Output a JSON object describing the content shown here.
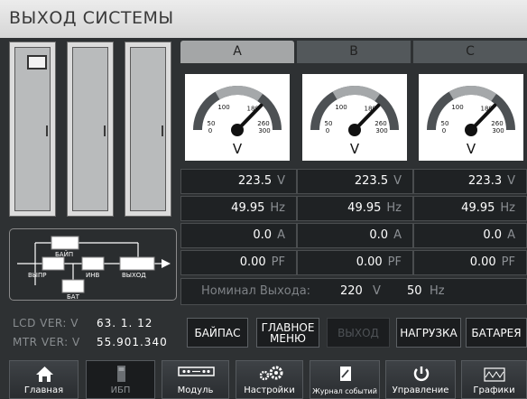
{
  "title": "ВЫХОД СИСТЕМЫ",
  "diagram": {
    "bypass": "БАЙП",
    "rectifier": "ВЫПР",
    "inverter": "ИНВ",
    "output": "ВЫХОД",
    "battery": "БАТ"
  },
  "phases": [
    {
      "label": "A",
      "voltage": "223.5",
      "frequency": "49.95",
      "current": "0.0",
      "pf": "0.00"
    },
    {
      "label": "B",
      "voltage": "223.5",
      "frequency": "49.95",
      "current": "0.0",
      "pf": "0.00"
    },
    {
      "label": "C",
      "voltage": "223.3",
      "frequency": "49.95",
      "current": "0.0",
      "pf": "0.00"
    }
  ],
  "gauge": {
    "ticks": [
      "0",
      "50",
      "100",
      "180",
      "260",
      "300"
    ],
    "unit": "V"
  },
  "units": {
    "voltage": "V",
    "frequency": "Hz",
    "current": "A",
    "pf": "PF"
  },
  "nominal": {
    "label": "Номинал Выхода:",
    "voltage": "220",
    "voltage_unit": "V",
    "frequency": "50",
    "frequency_unit": "Hz"
  },
  "versions": {
    "lcd_label": "LCD VER: V",
    "lcd_value": "63.  1. 12",
    "mtr_label": "MTR VER: V",
    "mtr_value": "55.901.340"
  },
  "buttons": {
    "bypass": "БАЙПАС",
    "main_menu_1": "ГЛАВНОЕ",
    "main_menu_2": "МЕНЮ",
    "output": "ВЫХОД",
    "load": "НАГРУЗКА",
    "battery": "БАТАРЕЯ"
  },
  "nav": {
    "home": "Главная",
    "ups": "ИБП",
    "module": "Модуль",
    "settings": "Настройки",
    "log": "Журнал событий",
    "control": "Управление",
    "charts": "Графики"
  }
}
